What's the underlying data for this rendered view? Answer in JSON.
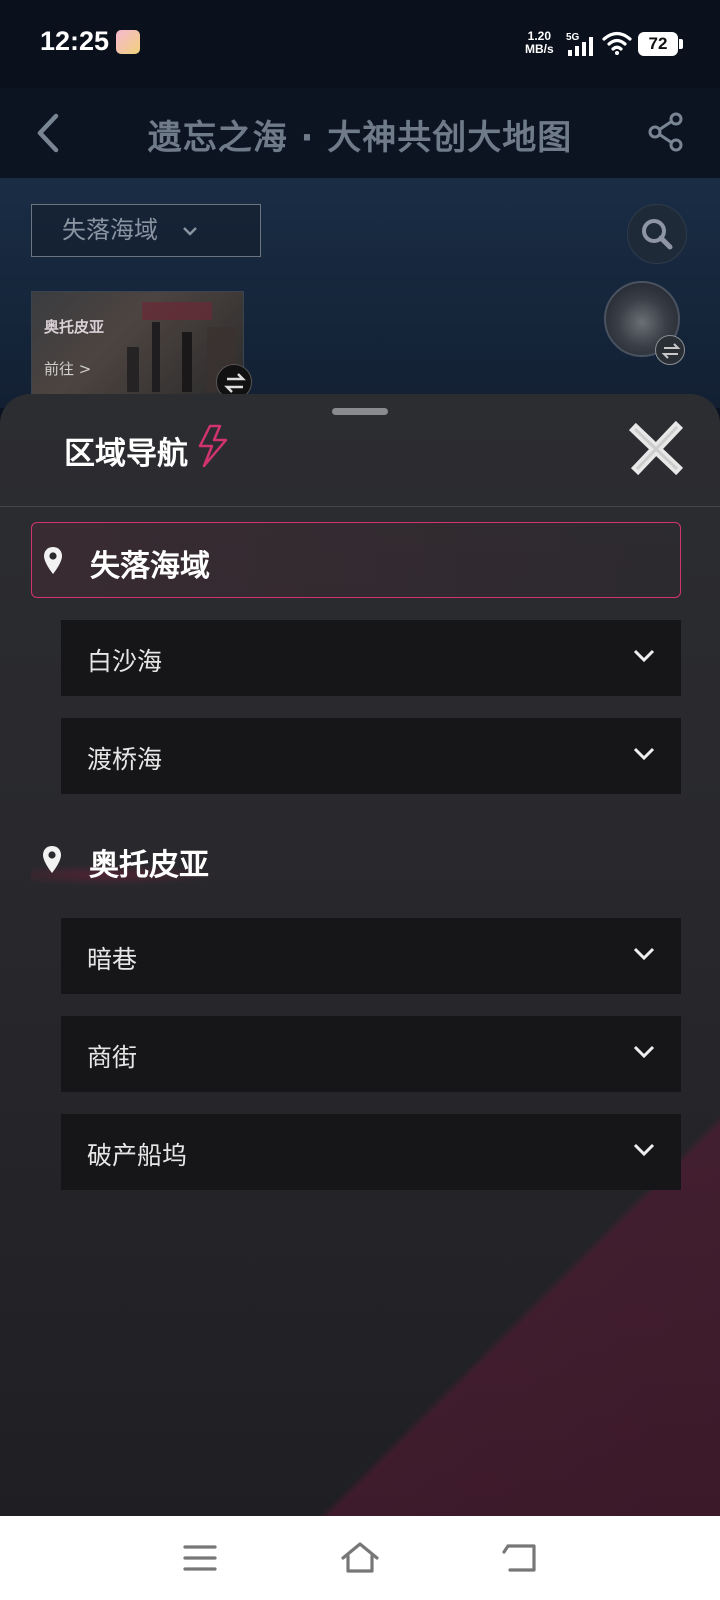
{
  "status_bar": {
    "time": "12:25",
    "net_speed_value": "1.20",
    "net_speed_unit": "MB/s",
    "network_type": "5G",
    "battery": "72"
  },
  "header": {
    "title": "遗忘之海 · 大神共创大地图"
  },
  "map": {
    "region_selector": "失落海域",
    "card": {
      "label": "奥托皮亚",
      "goto": "前往 >"
    }
  },
  "sheet": {
    "title": "区域导航",
    "sections": [
      {
        "label": "失落海域",
        "selected": true,
        "items": [
          "白沙海",
          "渡桥海"
        ]
      },
      {
        "label": "奥托皮亚",
        "selected": false,
        "items": [
          "暗巷",
          "商街",
          "破产船坞"
        ]
      }
    ]
  },
  "colors": {
    "accent": "#d0336e",
    "sheet_bg": "#2a2a2e",
    "item_bg": "#161618"
  }
}
